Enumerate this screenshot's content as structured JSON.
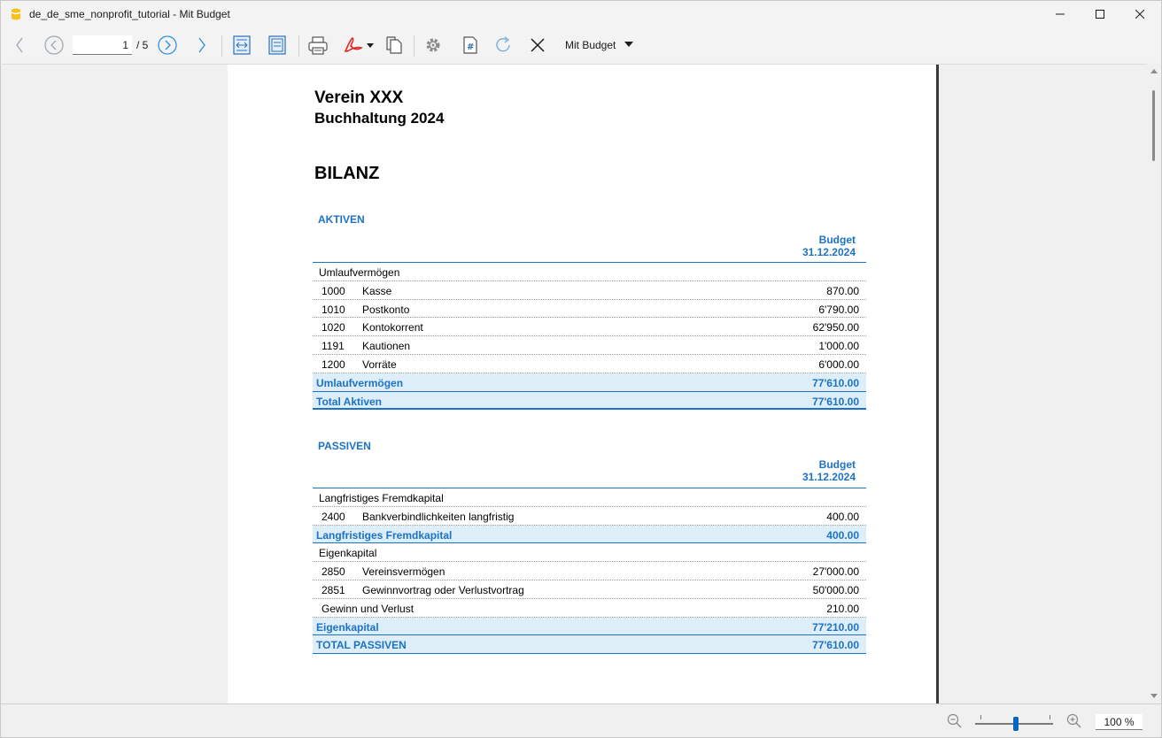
{
  "window": {
    "title": "de_de_sme_nonprofit_tutorial - Mit Budget"
  },
  "toolbar": {
    "page_value": "1",
    "page_total": "/ 5",
    "budget_select": "Mit Budget"
  },
  "document": {
    "company": "Verein XXX",
    "year": "Buchhaltung 2024",
    "title": "BILANZ",
    "aktiven": {
      "section": "AKTIVEN",
      "col_head_1": "Budget",
      "col_head_2": "31.12.2024",
      "group": "Umlaufvermögen",
      "rows": [
        {
          "acc": "1000",
          "desc": "Kasse",
          "amt": "870.00"
        },
        {
          "acc": "1010",
          "desc": "Postkonto",
          "amt": "6'790.00"
        },
        {
          "acc": "1020",
          "desc": "Kontokorrent",
          "amt": "62'950.00"
        },
        {
          "acc": "1191",
          "desc": "Kautionen",
          "amt": "1'000.00"
        },
        {
          "acc": "1200",
          "desc": "Vorräte",
          "amt": "6'000.00"
        }
      ],
      "subtotal_label": "Umlaufvermögen",
      "subtotal_amt": "77'610.00",
      "total_label": "Total Aktiven",
      "total_amt": "77'610.00"
    },
    "passiven": {
      "section": "PASSIVEN",
      "col_head_1": "Budget",
      "col_head_2": "31.12.2024",
      "group1": "Langfristiges Fremdkapital",
      "group1_rows": [
        {
          "acc": "2400",
          "desc": "Bankverbindlichkeiten langfristig",
          "amt": "400.00"
        }
      ],
      "group1_total_label": "Langfristiges Fremdkapital",
      "group1_total_amt": "400.00",
      "group2": "Eigenkapital",
      "group2_rows": [
        {
          "acc": "2850",
          "desc": "Vereinsvermögen",
          "amt": "27'000.00"
        },
        {
          "acc": "2851",
          "desc": "Gewinnvortrag oder Verlustvortrag",
          "amt": "50'000.00"
        }
      ],
      "profit_label": "Gewinn und Verlust",
      "profit_amt": "210.00",
      "group2_total_label": "Eigenkapital",
      "group2_total_amt": "77'210.00",
      "total_label": "TOTAL PASSIVEN",
      "total_amt": "77'610.00"
    }
  },
  "statusbar": {
    "zoom": "100 %",
    "zoom_level": 0.5
  },
  "colors": {
    "accent": "#1c72c7",
    "total_bg": "#ddeef8"
  }
}
